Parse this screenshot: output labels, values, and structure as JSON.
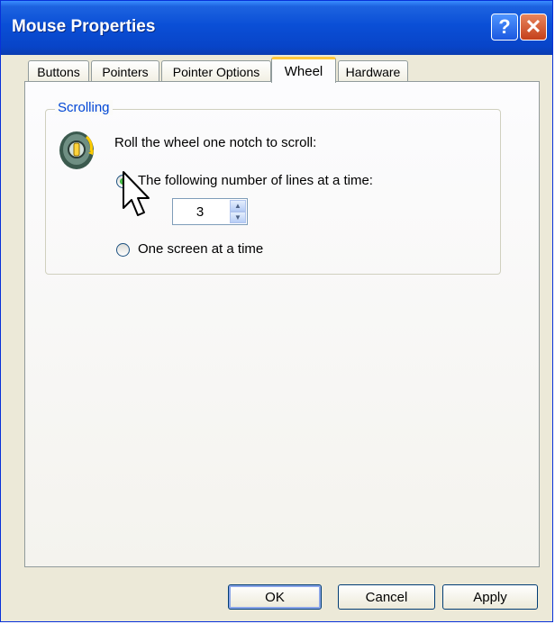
{
  "window": {
    "title": "Mouse Properties",
    "help_glyph": "?",
    "close_glyph": "✕"
  },
  "tabs": [
    {
      "label": "Buttons",
      "active": false
    },
    {
      "label": "Pointers",
      "active": false
    },
    {
      "label": "Pointer Options",
      "active": false
    },
    {
      "label": "Wheel",
      "active": true
    },
    {
      "label": "Hardware",
      "active": false
    }
  ],
  "scrolling": {
    "group_title": "Scrolling",
    "instruction": "Roll the wheel one notch to scroll:",
    "option_lines": {
      "label": "The following number of lines at a time:",
      "selected": true
    },
    "lines_value": "3",
    "option_screen": {
      "label": "One screen at a time",
      "selected": false
    }
  },
  "buttons": {
    "ok": "OK",
    "cancel": "Cancel",
    "apply": "Apply"
  },
  "icons": {
    "wheel": "mouse-wheel-icon",
    "pointer": "mouse-pointer-icon"
  },
  "colors": {
    "titlebar": "#0a4fd6",
    "active_tab_accent": "#ffc73c",
    "group_title": "#0046d5"
  }
}
